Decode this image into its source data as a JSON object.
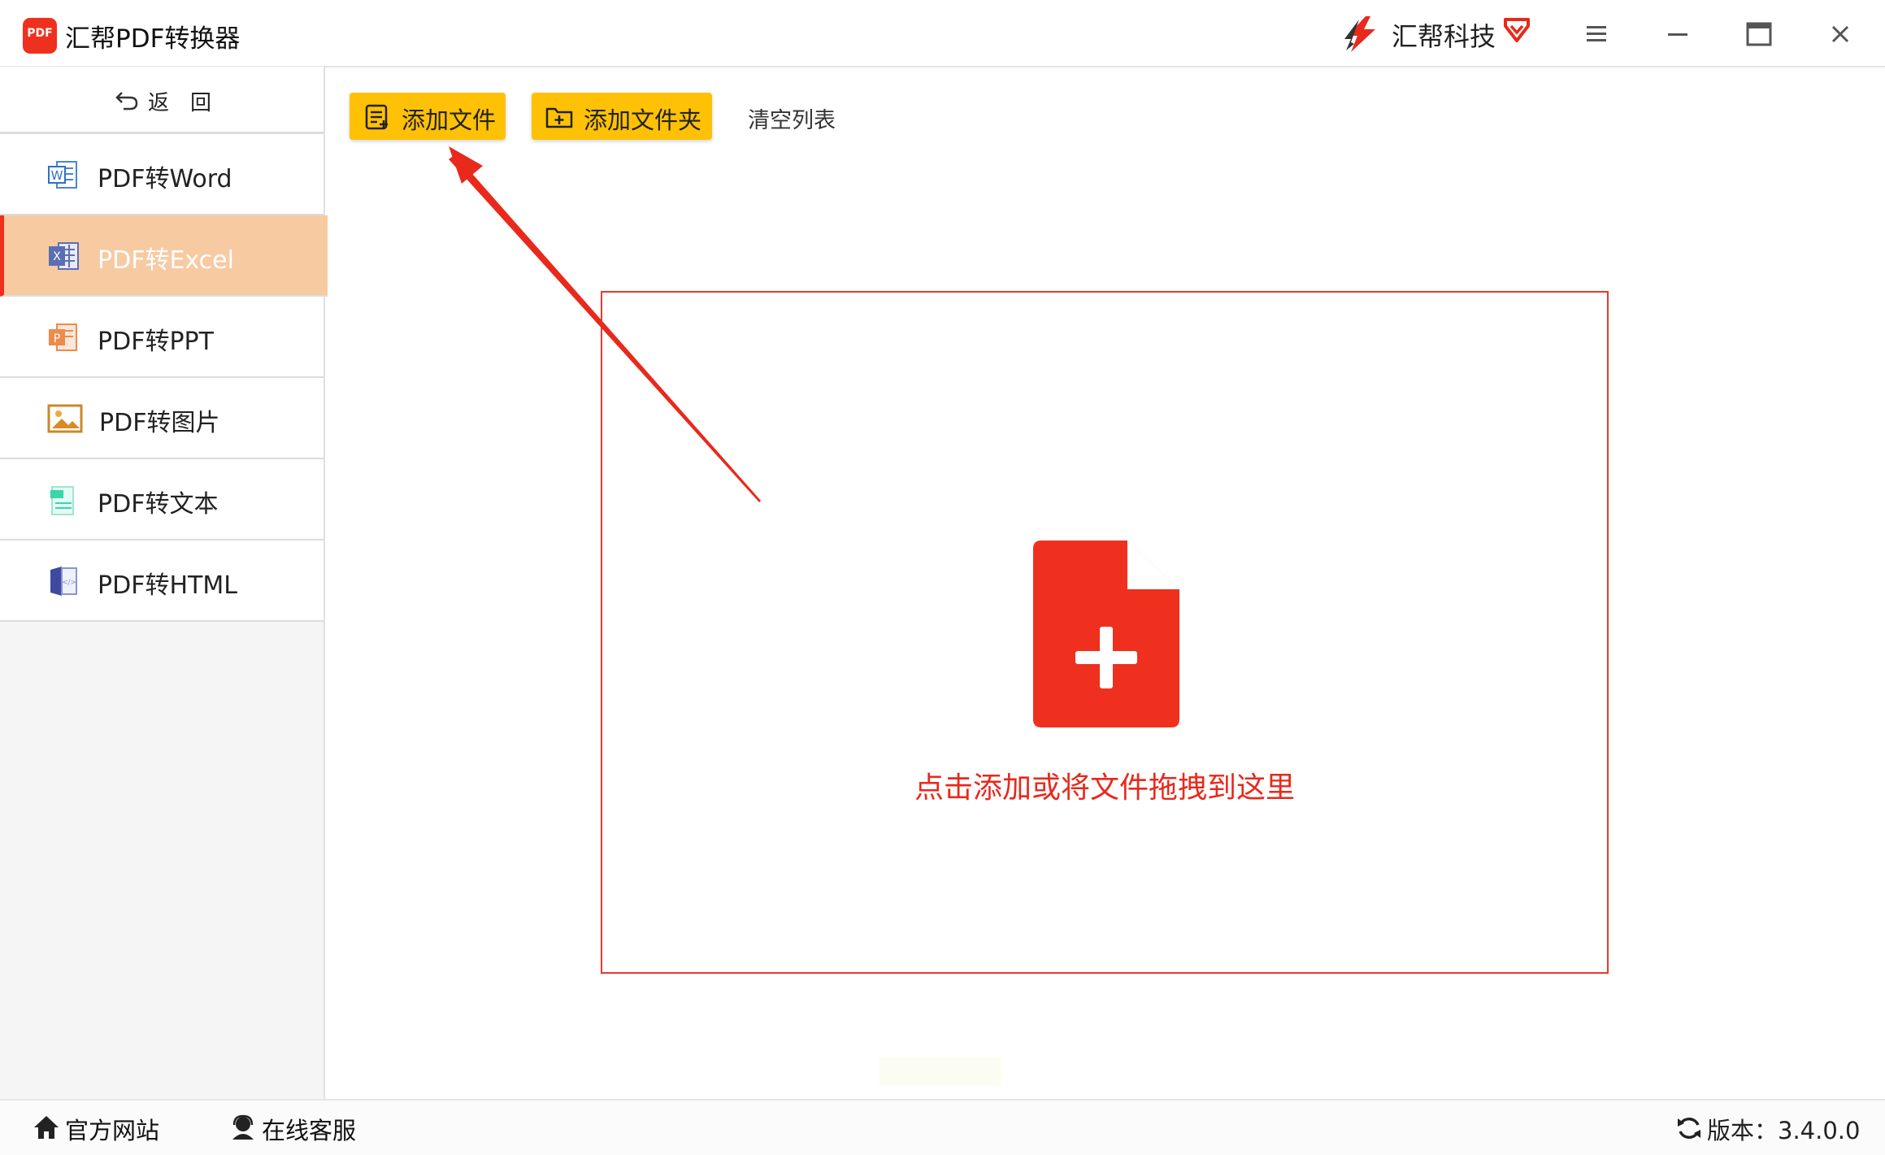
{
  "app": {
    "title": "汇帮PDF转换器",
    "logo_text": "PDF"
  },
  "brand": {
    "name": "汇帮科技"
  },
  "sidebar": {
    "back_label": "返回",
    "items": [
      {
        "label": "PDF转Word",
        "icon": "word-icon"
      },
      {
        "label": "PDF转Excel",
        "icon": "excel-icon",
        "active": true
      },
      {
        "label": "PDF转PPT",
        "icon": "ppt-icon"
      },
      {
        "label": "PDF转图片",
        "icon": "image-icon"
      },
      {
        "label": "PDF转文本",
        "icon": "text-doc-icon"
      },
      {
        "label": "PDF转HTML",
        "icon": "html-book-icon"
      }
    ]
  },
  "toolbar": {
    "add_file": "添加文件",
    "add_folder": "添加文件夹",
    "clear_list": "清空列表"
  },
  "dropzone": {
    "text": "点击添加或将文件拖拽到这里"
  },
  "statusbar": {
    "website": "官方网站",
    "support": "在线客服",
    "version_label": "版本：3.4.0.0"
  },
  "colors": {
    "accent": "#f0301e",
    "button": "#ffc106",
    "active_nav": "#f8caa2"
  }
}
